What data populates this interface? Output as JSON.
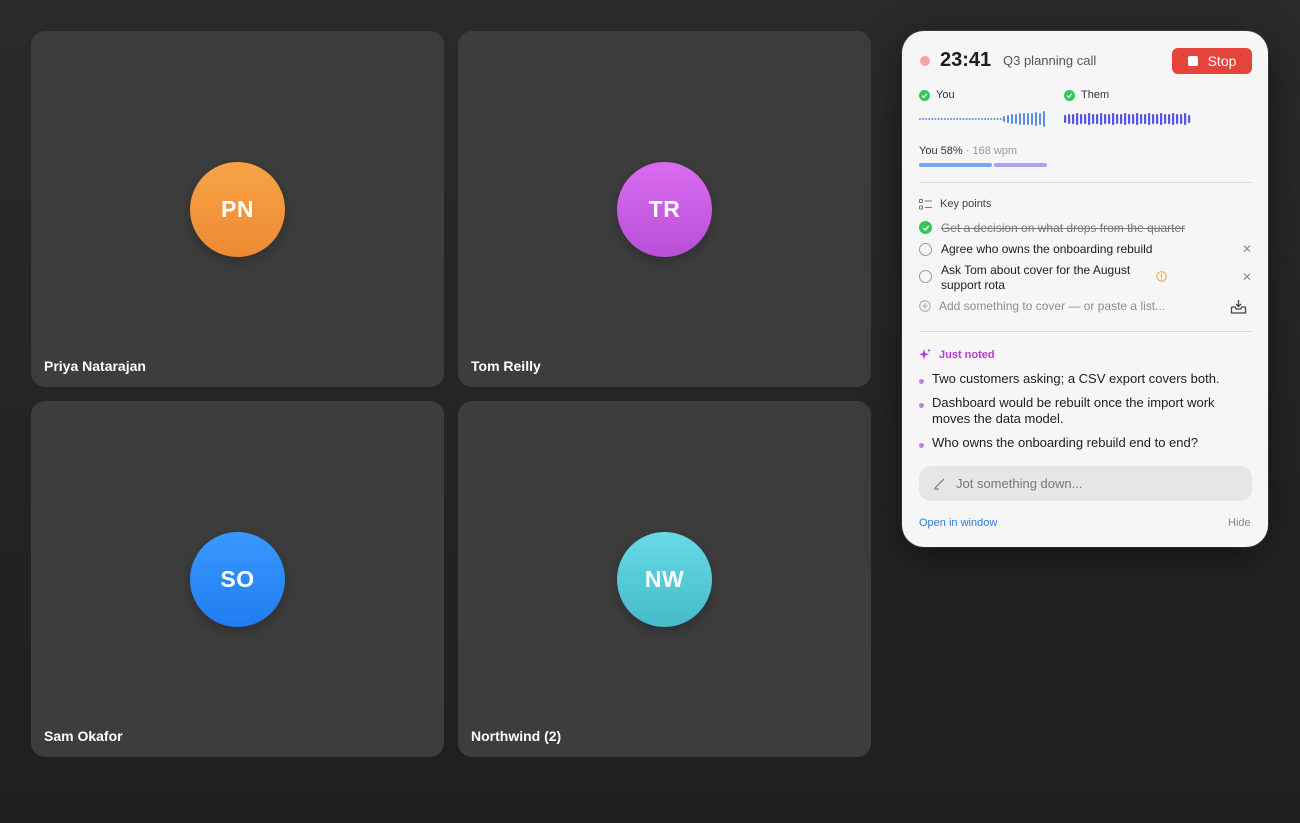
{
  "participants": [
    {
      "initials": "PN",
      "name": "Priya Natarajan",
      "color_top": "#f7a347",
      "color_bottom": "#ee8a32"
    },
    {
      "initials": "TR",
      "name": "Tom Reilly",
      "color_top": "#d96cf0",
      "color_bottom": "#b94fd8"
    },
    {
      "initials": "SO",
      "name": "Sam Okafor",
      "color_top": "#3a98ff",
      "color_bottom": "#1f7df0"
    },
    {
      "initials": "NW",
      "name": "Northwind (2)",
      "color_top": "#67dae6",
      "color_bottom": "#45bcc9"
    }
  ],
  "panel": {
    "timer": "23:41",
    "title": "Q3 planning call",
    "stop_label": "Stop",
    "speakers": [
      {
        "label": "You"
      },
      {
        "label": "Them"
      }
    ],
    "talk_share_label": "You 58%",
    "talk_separator": "·",
    "wpm_label": "168 wpm",
    "talk_share_fraction": 0.58,
    "key_points_title": "Key points",
    "key_points": [
      {
        "text": "Get a decision on what drops from the quarter",
        "done": true
      },
      {
        "text": "Agree who owns the onboarding rebuild",
        "done": false
      },
      {
        "text_line1": "Ask Tom about cover for the August",
        "text_line2": "support rota",
        "done": false,
        "warning": true
      }
    ],
    "add_placeholder": "Add something to cover — or paste a list...",
    "just_noted_title": "Just noted",
    "notes": [
      {
        "text": "Two customers asking; a CSV export covers both."
      },
      {
        "text": "Dashboard would be rebuilt once the import work moves the data model."
      },
      {
        "text": "Who owns the onboarding rebuild end to end?"
      }
    ],
    "jot_placeholder": "Jot something down...",
    "open_window": "Open in window",
    "hide": "Hide"
  },
  "colors": {
    "stop": "#e5443b",
    "you_wave": "#5b8ee6",
    "them_wave": "#5a55e0",
    "accent_purple": "#b13fd4",
    "link": "#2f7bd6"
  }
}
